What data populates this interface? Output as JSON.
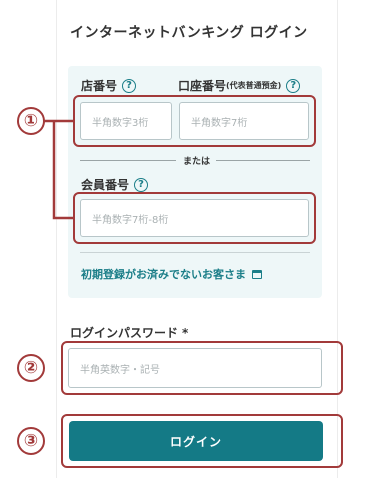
{
  "title": "インターネットバンキング ログイン",
  "branch": {
    "label": "店番号",
    "help": "?",
    "placeholder": "半角数字3桁"
  },
  "account": {
    "label": "口座番号",
    "label_note": "(代表普通預金)",
    "help": "?",
    "placeholder": "半角数字7桁"
  },
  "or_text": "または",
  "member": {
    "label": "会員番号",
    "help": "?",
    "placeholder": "半角数字7桁-8桁"
  },
  "first_time_link": "初期登録がお済みでないお客さま",
  "password": {
    "label": "ログインパスワード",
    "required_mark": "*",
    "placeholder": "半角英数字・記号"
  },
  "login_button": "ログイン",
  "annotations": {
    "one": "①",
    "two": "②",
    "three": "③"
  },
  "colors": {
    "accent": "#147a86",
    "annotation": "#a23a3a",
    "panel": "#eef7f8"
  }
}
